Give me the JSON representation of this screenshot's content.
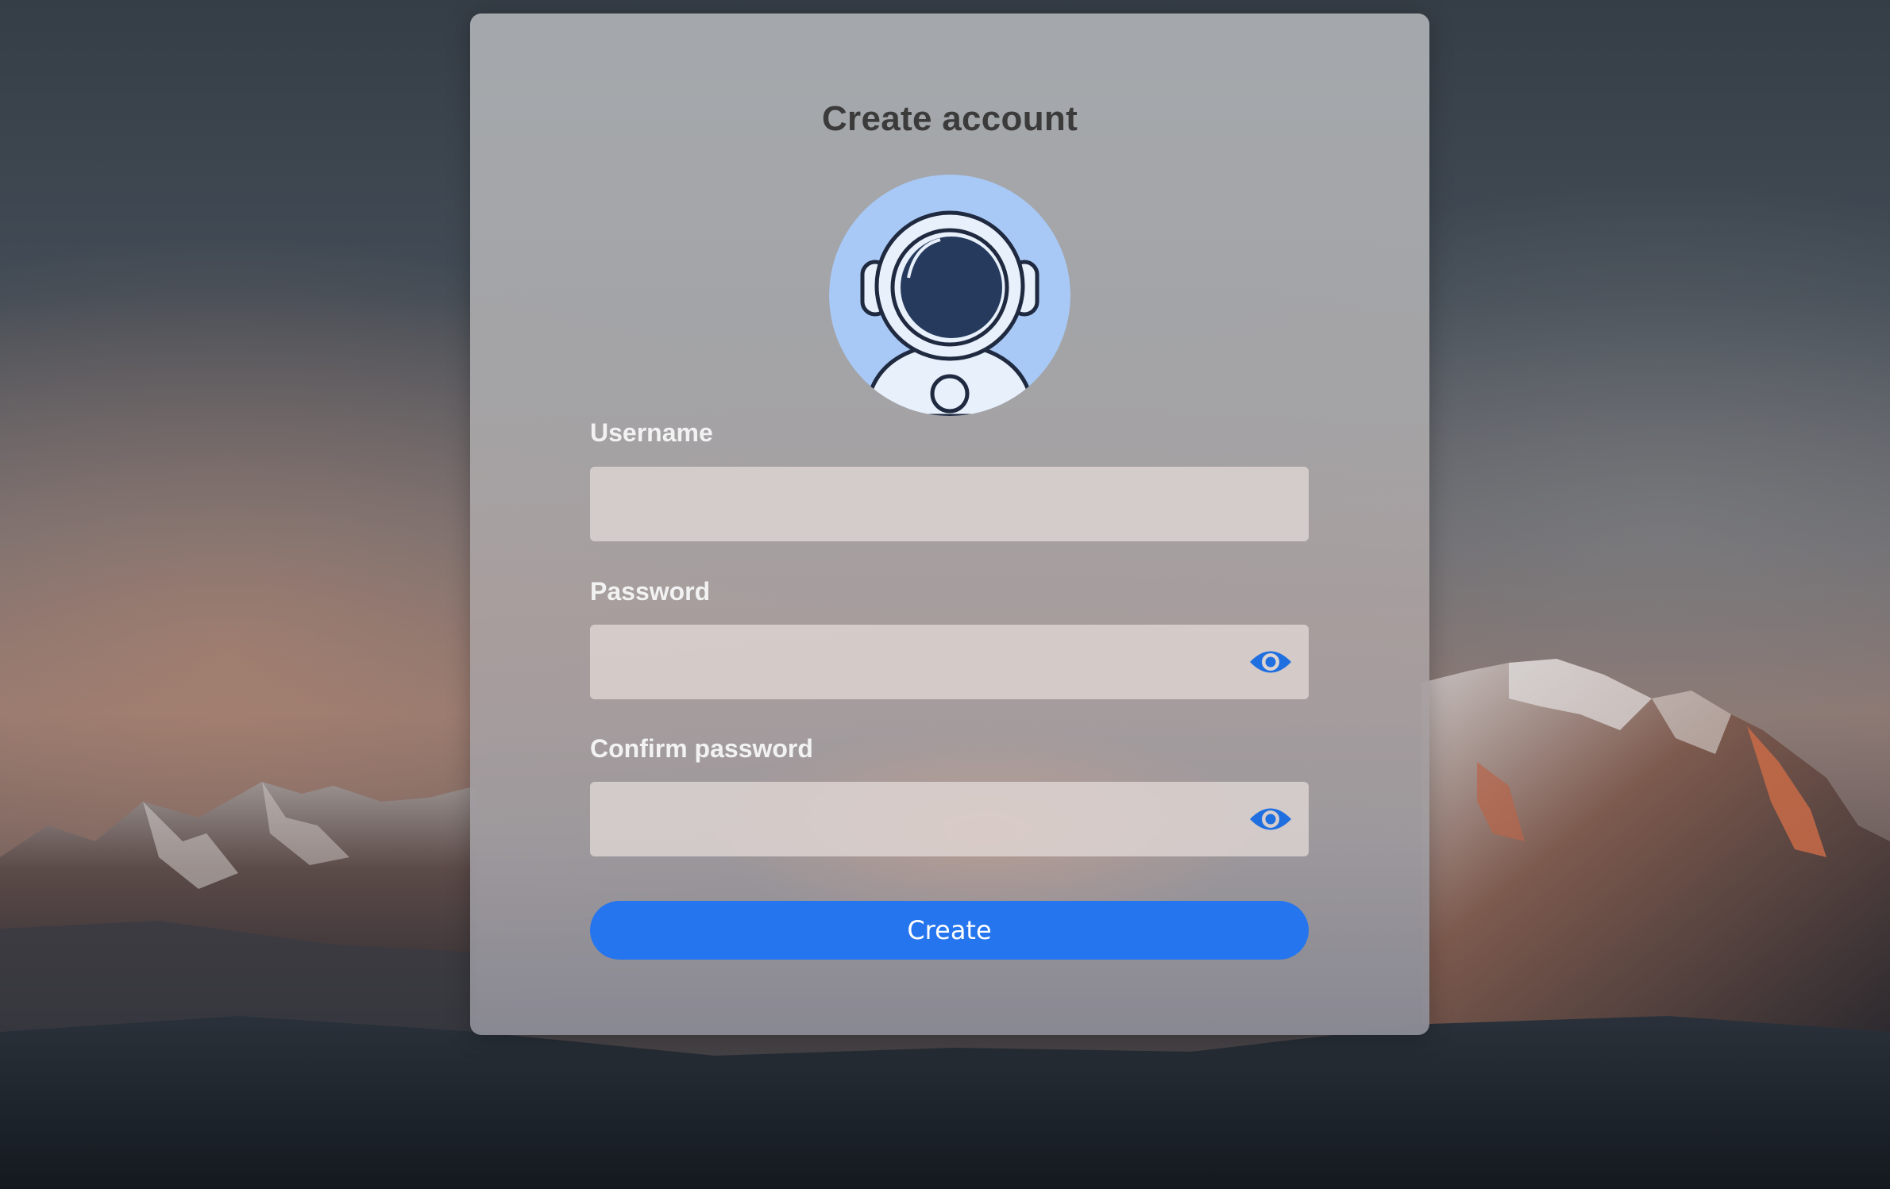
{
  "form": {
    "title": "Create account",
    "avatar_icon": "astronaut-avatar",
    "username": {
      "label": "Username",
      "value": "",
      "placeholder": ""
    },
    "password": {
      "label": "Password",
      "value": "",
      "placeholder": "",
      "toggle_icon": "eye-icon"
    },
    "confirm_password": {
      "label": "Confirm password",
      "value": "",
      "placeholder": "",
      "toggle_icon": "eye-icon"
    },
    "submit_label": "Create"
  },
  "colors": {
    "accent": "#2575ee",
    "avatar_bg": "#a8c8f5",
    "visor": "#253a5c"
  }
}
